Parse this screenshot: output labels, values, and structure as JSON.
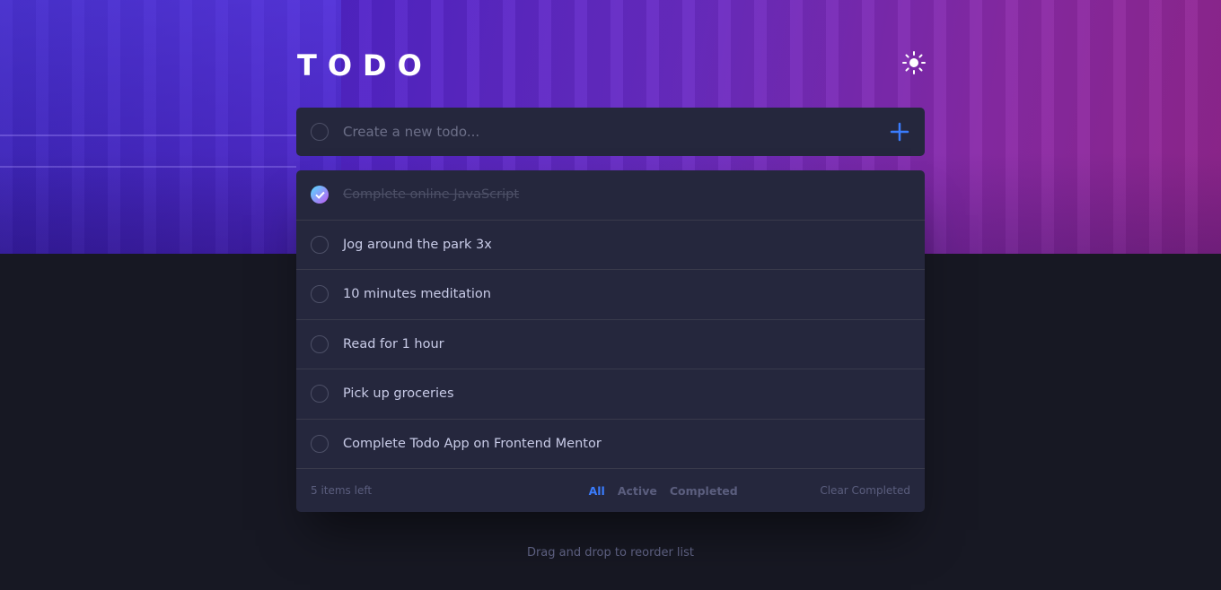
{
  "header": {
    "title": "TODO",
    "theme_icon": "sun-icon"
  },
  "create": {
    "placeholder": "Create a new todo...",
    "add_icon": "plus-icon"
  },
  "todos": [
    {
      "text": "Complete online JavaScript",
      "completed": true
    },
    {
      "text": "Jog around the park 3x",
      "completed": false
    },
    {
      "text": "10 minutes meditation",
      "completed": false
    },
    {
      "text": "Read for 1 hour",
      "completed": false
    },
    {
      "text": "Pick up groceries",
      "completed": false
    },
    {
      "text": "Complete Todo App on Frontend Mentor",
      "completed": false
    }
  ],
  "footer": {
    "items_left": "5 items left",
    "filters": [
      "All",
      "Active",
      "Completed"
    ],
    "active_filter": "All",
    "clear_label": "Clear Completed"
  },
  "hint": "Drag and drop to reorder list",
  "colors": {
    "accent": "#3a7cfd",
    "panel": "#25273d",
    "background": "#171823",
    "check_gradient_start": "#55ddff",
    "check_gradient_end": "#c058f3"
  }
}
